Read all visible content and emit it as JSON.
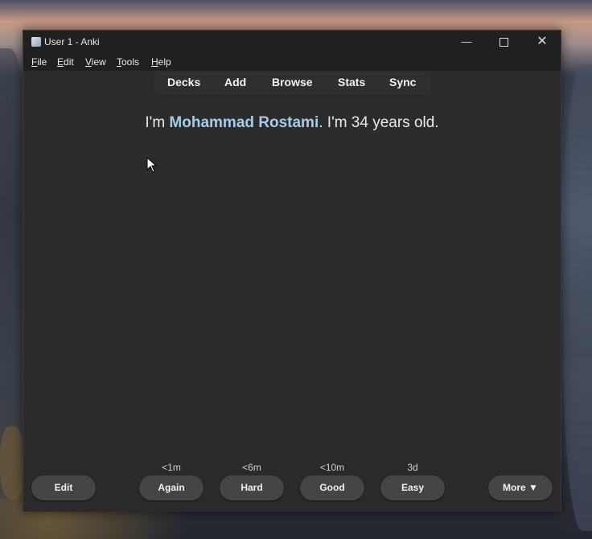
{
  "window": {
    "title": "User 1 - Anki",
    "minimize_glyph": "—",
    "close_glyph": "✕"
  },
  "menu": {
    "items": [
      {
        "first": "F",
        "rest": "ile"
      },
      {
        "first": "E",
        "rest": "dit"
      },
      {
        "first": "V",
        "rest": "iew"
      },
      {
        "first": "T",
        "rest": "ools"
      },
      {
        "first": "H",
        "rest": "elp"
      }
    ]
  },
  "toolbar": {
    "decks": "Decks",
    "add": "Add",
    "browse": "Browse",
    "stats": "Stats",
    "sync": "Sync"
  },
  "card": {
    "prefix": "I'm ",
    "name": "Mohammad Rostami",
    "suffix": ". I'm 34 years old.",
    "name_color": "#a3cde8"
  },
  "answer_bar": {
    "edit": "Edit",
    "again": {
      "label": "Again",
      "interval": "<1m"
    },
    "hard": {
      "label": "Hard",
      "interval": "<6m"
    },
    "good": {
      "label": "Good",
      "interval": "<10m"
    },
    "easy": {
      "label": "Easy",
      "interval": "3d"
    },
    "more": "More ▼"
  },
  "colors": {
    "window_bg": "#2c2c2c",
    "titlebar_bg": "#202020",
    "button_bg": "#454545"
  }
}
